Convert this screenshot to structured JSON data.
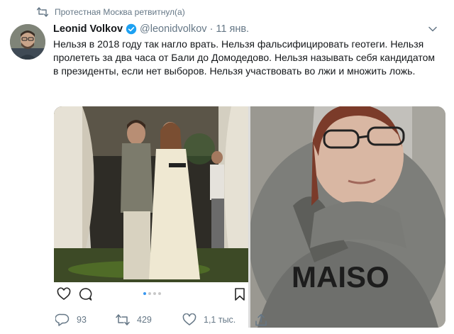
{
  "retweet": {
    "text": "Протестная Москва ретвитнул(а)"
  },
  "tweet": {
    "name": "Leonid Volkov",
    "handle": "@leonidvolkov",
    "separator": "·",
    "time": "11 янв.",
    "text": "Нельзя в 2018 году так нагло врать. Нельзя фальсифицировать геотеги. Нельзя пролететь за два часа от Бали до Домодедово. Нельзя называть себя кандидатом в президенты, если нет выборов. Нельзя участвовать во лжи и множить ложь."
  },
  "media": {
    "left_photo_alt": "",
    "right_photo_alt": "",
    "right_sweater_text": "MAISO"
  },
  "actions": {
    "reply_count": "93",
    "retweet_count": "429",
    "like_count": "1,1 тыс."
  },
  "colors": {
    "secondary_text": "#657786",
    "verified_blue": "#1da1f2",
    "insta_dot_active": "#3897f0"
  },
  "icons": [
    "retweet-icon",
    "verified-badge-icon",
    "chevron-down-icon",
    "instagram-heart-icon",
    "instagram-comment-icon",
    "instagram-bookmark-icon",
    "reply-icon",
    "retweet-icon",
    "like-icon",
    "share-icon"
  ]
}
